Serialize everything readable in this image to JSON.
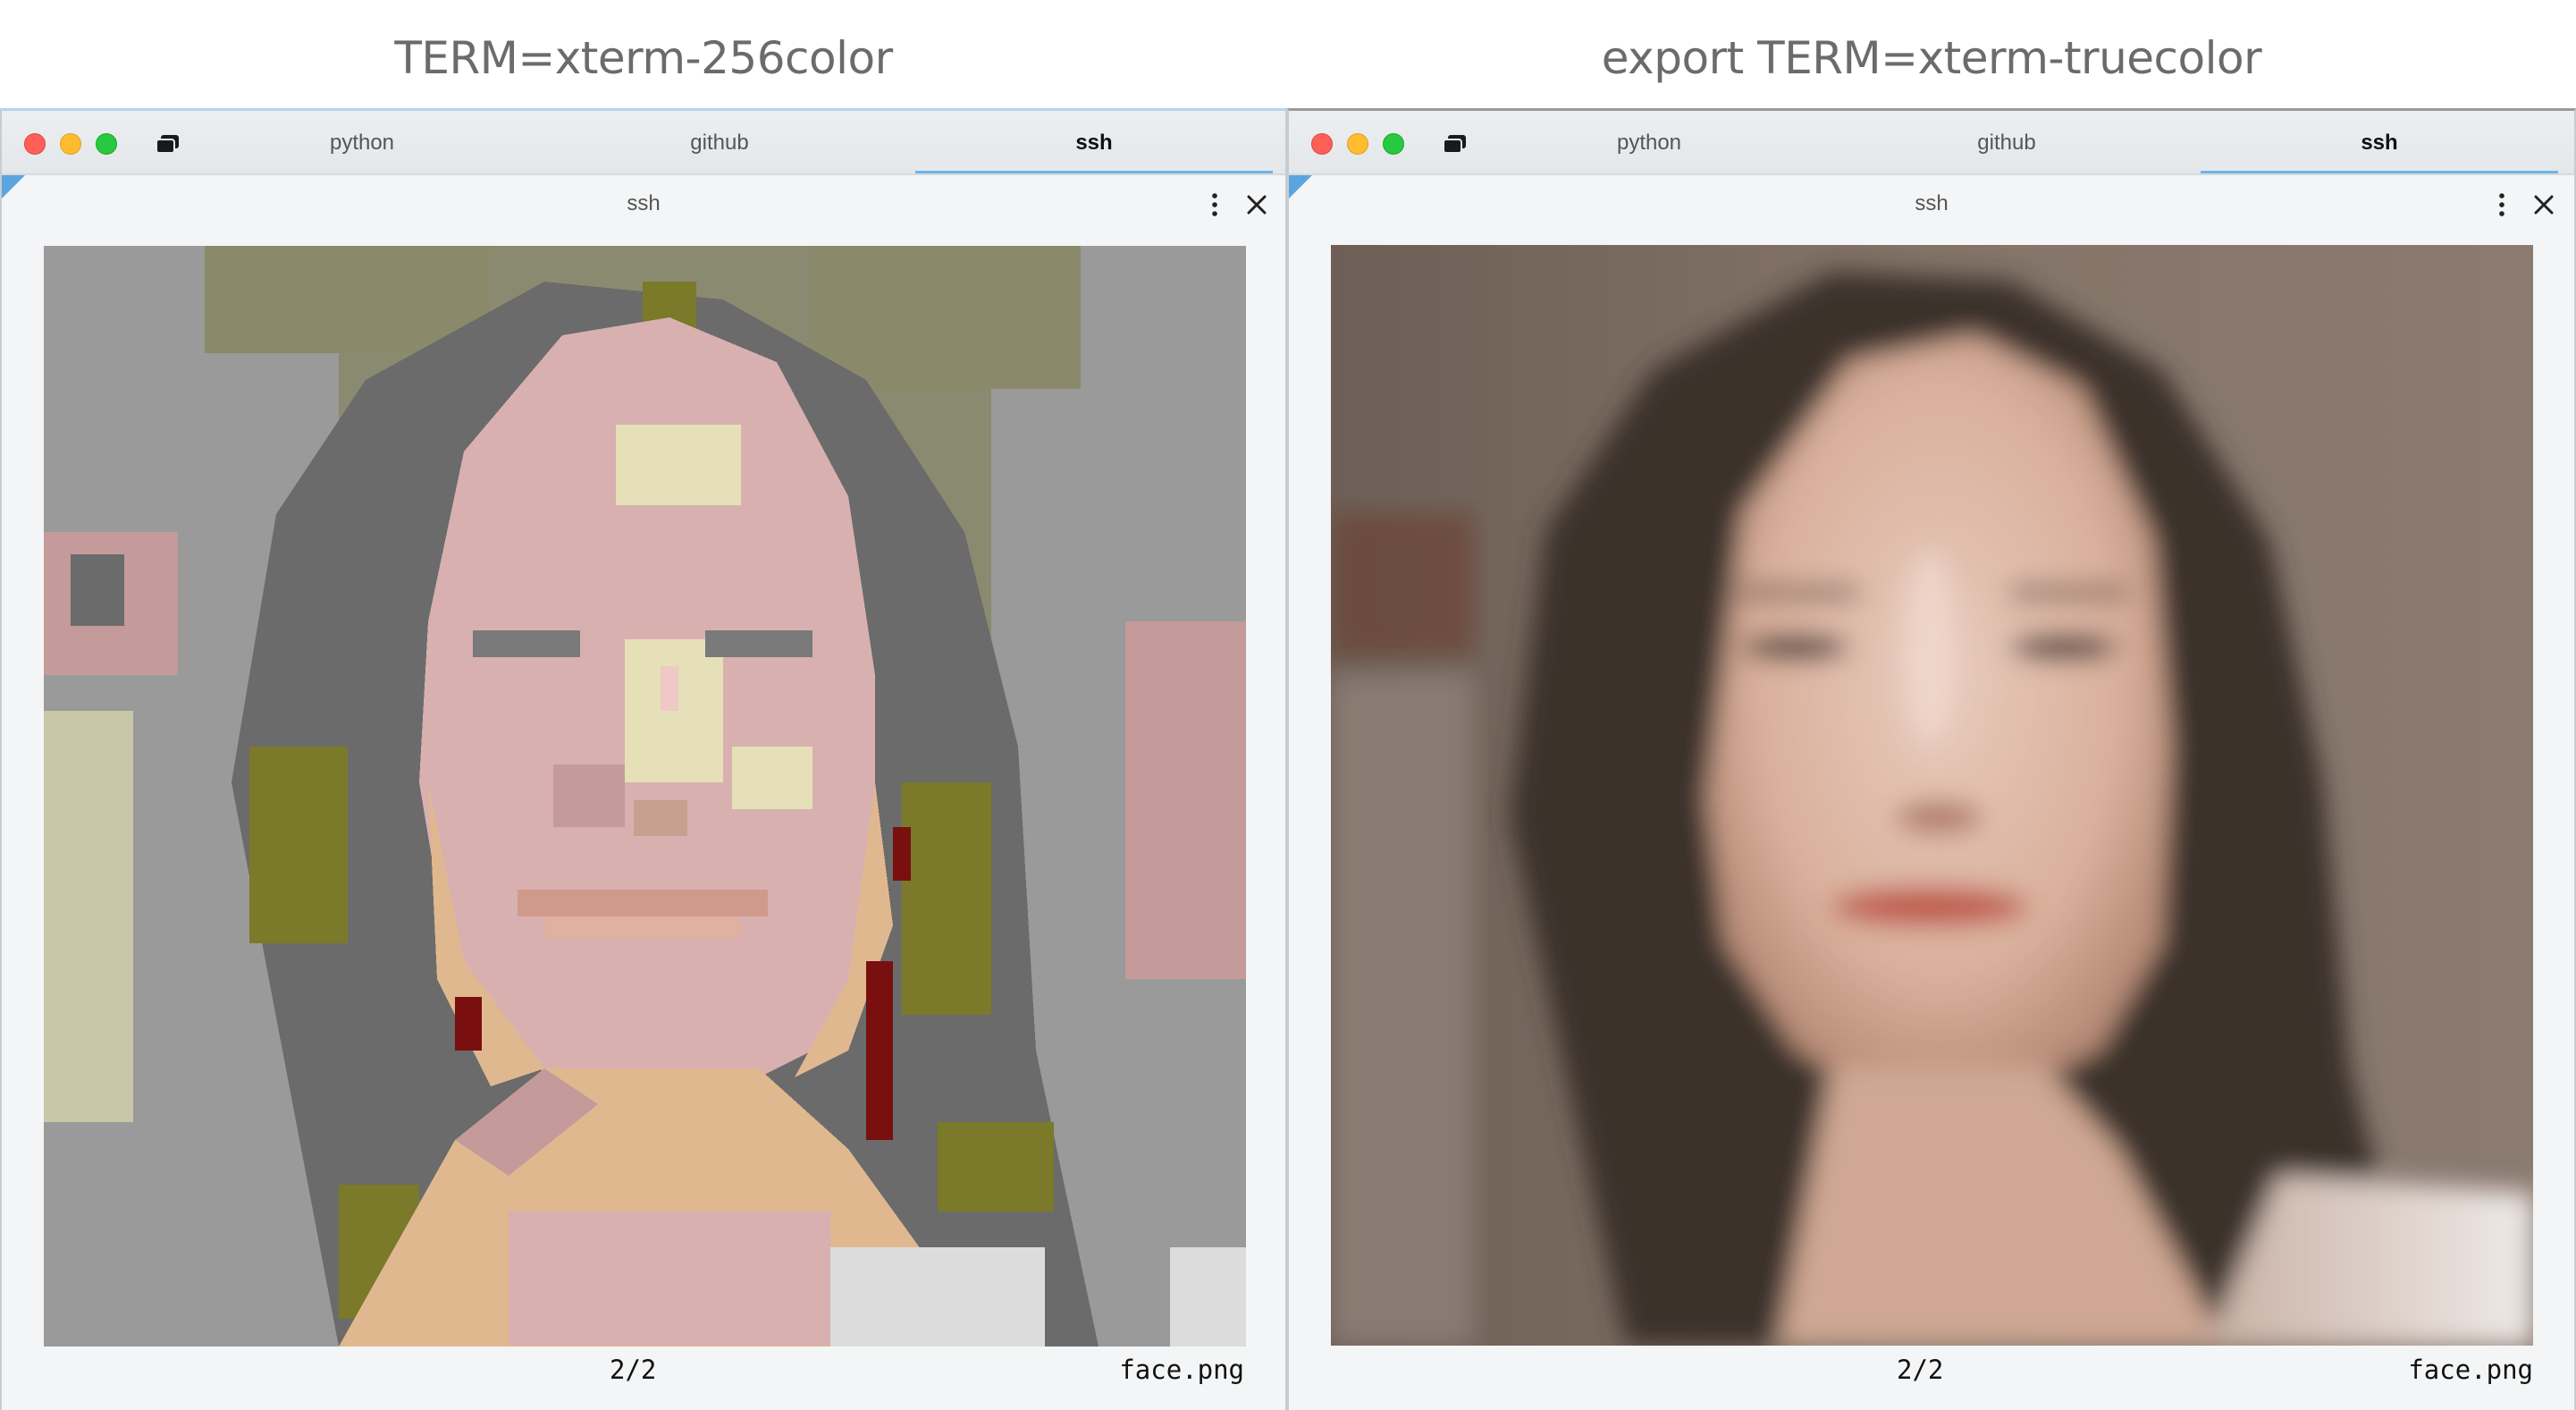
{
  "captions": {
    "left": "TERM=xterm-256color",
    "right": "export TERM=xterm-truecolor"
  },
  "windows": [
    {
      "tabs": [
        "python",
        "github",
        "ssh"
      ],
      "active_tab": "ssh",
      "pane_title": "ssh",
      "pager": "2/2",
      "filename": "face.png",
      "image_mode": "posterized-256-color"
    },
    {
      "tabs": [
        "python",
        "github",
        "ssh"
      ],
      "active_tab": "ssh",
      "pane_title": "ssh",
      "pager": "2/2",
      "filename": "face.png",
      "image_mode": "truecolor"
    }
  ],
  "colors": {
    "tab_underline": "#6db3e8",
    "corner_mark": "#5aa5e0",
    "close": "#fe5f57",
    "minimize": "#febc2e",
    "zoom": "#28c840"
  },
  "icons": [
    "tabs-overview-icon",
    "more-vertical-icon",
    "close-icon"
  ]
}
